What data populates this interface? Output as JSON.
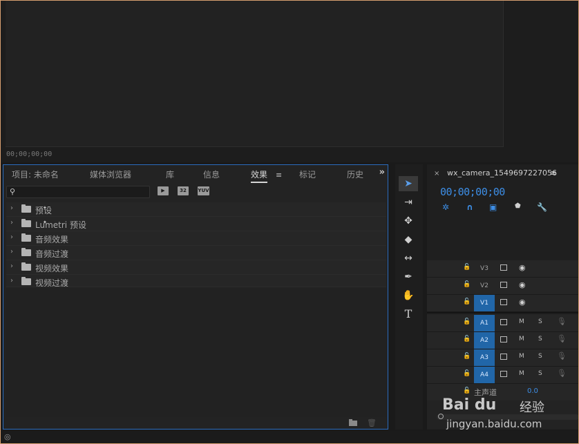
{
  "monitor": {
    "timecode": "00;00;00;00"
  },
  "effects_panel": {
    "tabs": [
      {
        "label": "项目: 未命名"
      },
      {
        "label": "媒体浏览器"
      },
      {
        "label": "库"
      },
      {
        "label": "信息"
      },
      {
        "label": "效果",
        "active": true
      },
      {
        "label": "标记"
      },
      {
        "label": "历史"
      }
    ],
    "menu_glyph": "≡",
    "overflow_glyph": "»",
    "search": {
      "placeholder": "",
      "value": ""
    },
    "filter_badges": [
      "▶",
      "32",
      "YUV"
    ],
    "tree": [
      {
        "label": "预设",
        "icon": "preset-folder-icon"
      },
      {
        "label": "Lumetri 预设",
        "icon": "preset-folder-icon"
      },
      {
        "label": "音频效果",
        "icon": "folder-icon"
      },
      {
        "label": "音频过渡",
        "icon": "folder-icon"
      },
      {
        "label": "视频效果",
        "icon": "folder-icon"
      },
      {
        "label": "视频过渡",
        "icon": "folder-icon"
      }
    ]
  },
  "tools": [
    {
      "name": "selection-tool",
      "glyph": "➤",
      "active": true
    },
    {
      "name": "track-select-tool",
      "glyph": "⇥"
    },
    {
      "name": "ripple-edit-tool",
      "glyph": "✥"
    },
    {
      "name": "razor-tool",
      "glyph": "◆"
    },
    {
      "name": "slip-tool",
      "glyph": "↔"
    },
    {
      "name": "pen-tool",
      "glyph": "✒"
    },
    {
      "name": "hand-tool",
      "glyph": "✋"
    },
    {
      "name": "type-tool",
      "glyph": "T"
    }
  ],
  "timeline": {
    "close_glyph": "×",
    "sequence_name": "wx_camera_1549697227056",
    "menu_glyph": "≡",
    "timecode": "00;00;00;00",
    "video_tracks": [
      {
        "name": "V3",
        "selected": false
      },
      {
        "name": "V2",
        "selected": false
      },
      {
        "name": "V1",
        "selected": true
      }
    ],
    "audio_tracks": [
      {
        "name": "A1",
        "selected": true
      },
      {
        "name": "A2",
        "selected": true
      },
      {
        "name": "A3",
        "selected": true
      },
      {
        "name": "A4",
        "selected": true
      }
    ],
    "mute_label": "M",
    "solo_label": "S",
    "master": {
      "label": "主声道",
      "value": "0.0"
    }
  },
  "watermark": {
    "logo": "Bai du",
    "jingyan": "经验",
    "url": "jingyan.baidu.com"
  },
  "colors": {
    "accent": "#3d8ee6",
    "selected_track": "#2166a8",
    "panel_border": "#2b6dc0"
  }
}
